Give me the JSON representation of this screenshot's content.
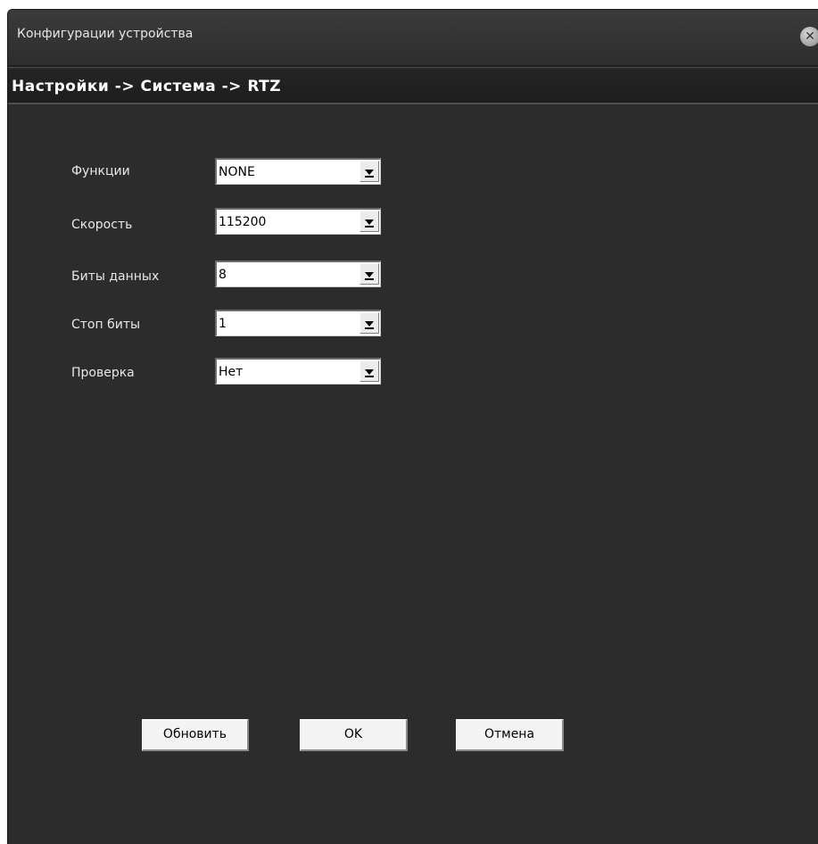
{
  "window": {
    "title": "Конфигурации устройства"
  },
  "breadcrumb": "Настройки -> Система -> RTZ",
  "form": {
    "rows": [
      {
        "label": "Функции",
        "value": "NONE"
      },
      {
        "label": "Скорость",
        "value": "115200"
      },
      {
        "label": "Биты данных",
        "value": "8"
      },
      {
        "label": "Стоп биты",
        "value": "1"
      },
      {
        "label": "Проверка",
        "value": "Нет"
      }
    ]
  },
  "buttons": {
    "refresh": "Обновить",
    "ok": "OK",
    "cancel": "Отмена"
  },
  "icons": {
    "close": "close-icon",
    "dropdown": "chevron-down-icon"
  }
}
